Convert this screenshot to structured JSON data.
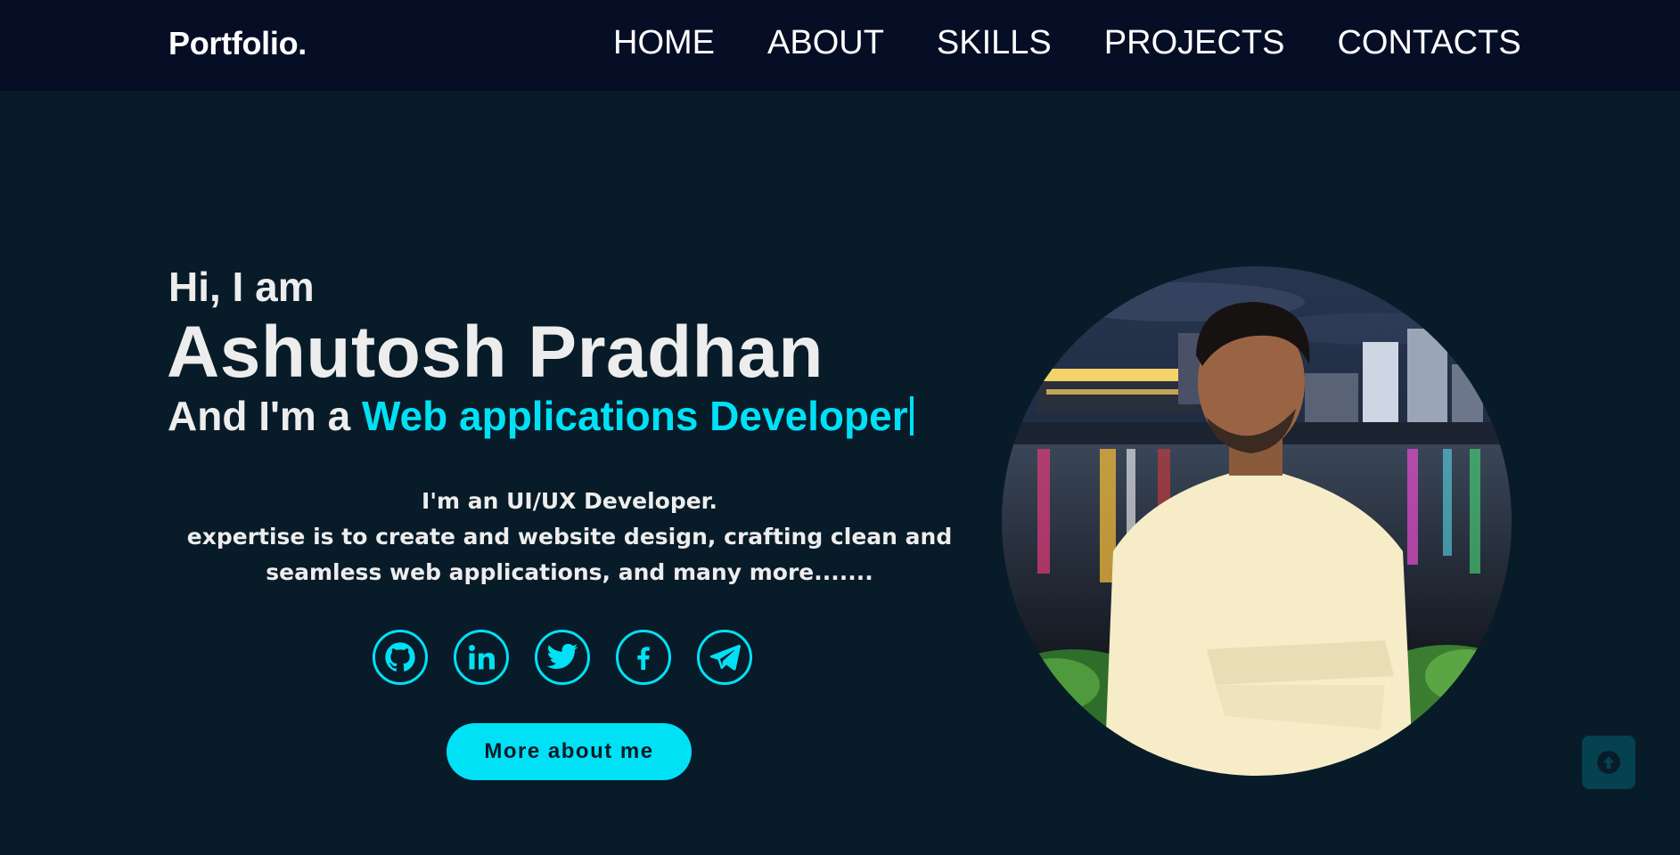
{
  "nav": {
    "logo": "Portfolio.",
    "links": [
      "HOME",
      "ABOUT",
      "SKILLS",
      "PROJECTS",
      "CONTACTS"
    ]
  },
  "hero": {
    "greeting": "Hi, I am",
    "name": "Ashutosh Pradhan",
    "role_prefix": "And I'm a ",
    "role_typed": "Web applications Developer",
    "intro_lines": [
      "I'm an UI/UX Developer.",
      "expertise is to create and website design, crafting clean and",
      "seamless web applications, and many more......."
    ],
    "cta_label": "More about me"
  },
  "socials": [
    {
      "icon": "github-icon"
    },
    {
      "icon": "linkedin-icon"
    },
    {
      "icon": "twitter-icon"
    },
    {
      "icon": "facebook-icon"
    },
    {
      "icon": "telegram-icon"
    }
  ],
  "colors": {
    "background": "#081b29",
    "navbar": "#050e25",
    "accent": "#00e1f5",
    "text": "#ededed",
    "scroll_button": "#05414e"
  }
}
